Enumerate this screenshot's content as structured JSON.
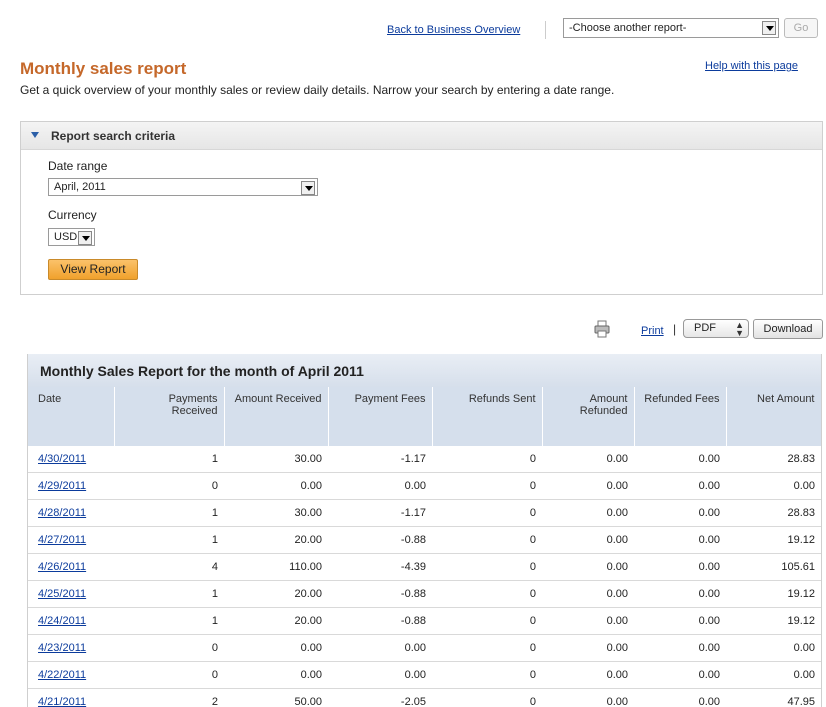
{
  "top": {
    "back_link": "Back to Business Overview",
    "report_select_value": "-Choose another report-",
    "go_label": "Go"
  },
  "header": {
    "title": "Monthly sales report",
    "help_link": "Help with this page",
    "description": "Get a quick overview of your monthly sales or review daily details. Narrow your search by entering a date range."
  },
  "criteria": {
    "title": "Report search criteria",
    "date_range_label": "Date range",
    "date_range_value": "April, 2011",
    "currency_label": "Currency",
    "currency_value": "USD",
    "view_report_label": "View Report"
  },
  "export": {
    "print_label": "Print",
    "separator": "|",
    "format_value": "PDF",
    "download_label": "Download"
  },
  "table": {
    "title": "Monthly Sales Report for the month of April 2011",
    "columns": [
      "Date",
      "Payments Received",
      "Amount Received",
      "Payment Fees",
      "Refunds Sent",
      "Amount Refunded",
      "Refunded Fees",
      "Net Amount"
    ],
    "rows": [
      [
        "4/30/2011",
        "1",
        "30.00",
        "-1.17",
        "0",
        "0.00",
        "0.00",
        "28.83"
      ],
      [
        "4/29/2011",
        "0",
        "0.00",
        "0.00",
        "0",
        "0.00",
        "0.00",
        "0.00"
      ],
      [
        "4/28/2011",
        "1",
        "30.00",
        "-1.17",
        "0",
        "0.00",
        "0.00",
        "28.83"
      ],
      [
        "4/27/2011",
        "1",
        "20.00",
        "-0.88",
        "0",
        "0.00",
        "0.00",
        "19.12"
      ],
      [
        "4/26/2011",
        "4",
        "110.00",
        "-4.39",
        "0",
        "0.00",
        "0.00",
        "105.61"
      ],
      [
        "4/25/2011",
        "1",
        "20.00",
        "-0.88",
        "0",
        "0.00",
        "0.00",
        "19.12"
      ],
      [
        "4/24/2011",
        "1",
        "20.00",
        "-0.88",
        "0",
        "0.00",
        "0.00",
        "19.12"
      ],
      [
        "4/23/2011",
        "0",
        "0.00",
        "0.00",
        "0",
        "0.00",
        "0.00",
        "0.00"
      ],
      [
        "4/22/2011",
        "0",
        "0.00",
        "0.00",
        "0",
        "0.00",
        "0.00",
        "0.00"
      ],
      [
        "4/21/2011",
        "2",
        "50.00",
        "-2.05",
        "0",
        "0.00",
        "0.00",
        "47.95"
      ]
    ]
  },
  "icons": {
    "dropdown": "chevron-down-icon",
    "collapse": "triangle-down-icon",
    "printer": "printer-icon"
  }
}
